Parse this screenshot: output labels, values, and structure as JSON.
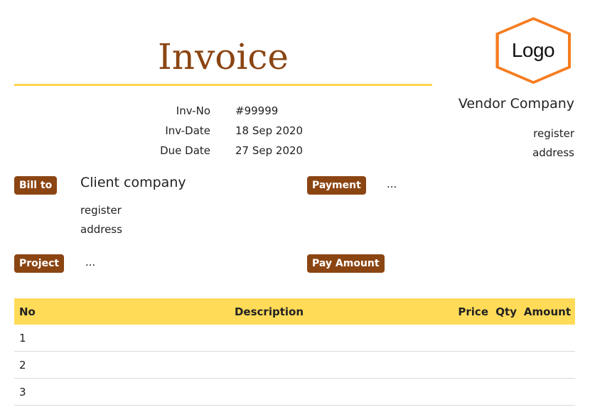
{
  "title": "Invoice",
  "logo": "Logo",
  "vendor": {
    "name": "Vendor Company",
    "address_lines": [
      "register",
      "address"
    ]
  },
  "meta": [
    {
      "label": "Inv-No",
      "value": "#99999"
    },
    {
      "label": "Inv-Date",
      "value": "18 Sep 2020"
    },
    {
      "label": "Due Date",
      "value": "27 Sep 2020"
    }
  ],
  "bill_to": {
    "label": "Bill to",
    "name": "Client company",
    "address_lines": [
      "register",
      "address"
    ]
  },
  "payment": {
    "label": "Payment",
    "value": "..."
  },
  "project": {
    "label": "Project",
    "value": "..."
  },
  "pay_amount": {
    "label": "Pay Amount",
    "value": ""
  },
  "table": {
    "headers": [
      "No",
      "Description",
      "Price",
      "Qty",
      "Amount"
    ],
    "rows": [
      {
        "no": "1"
      },
      {
        "no": "2"
      },
      {
        "no": "3"
      }
    ]
  },
  "colors": {
    "brown": "#8b4513",
    "yellow": "#ffdb58",
    "logo_orange": "#f57c1f"
  }
}
